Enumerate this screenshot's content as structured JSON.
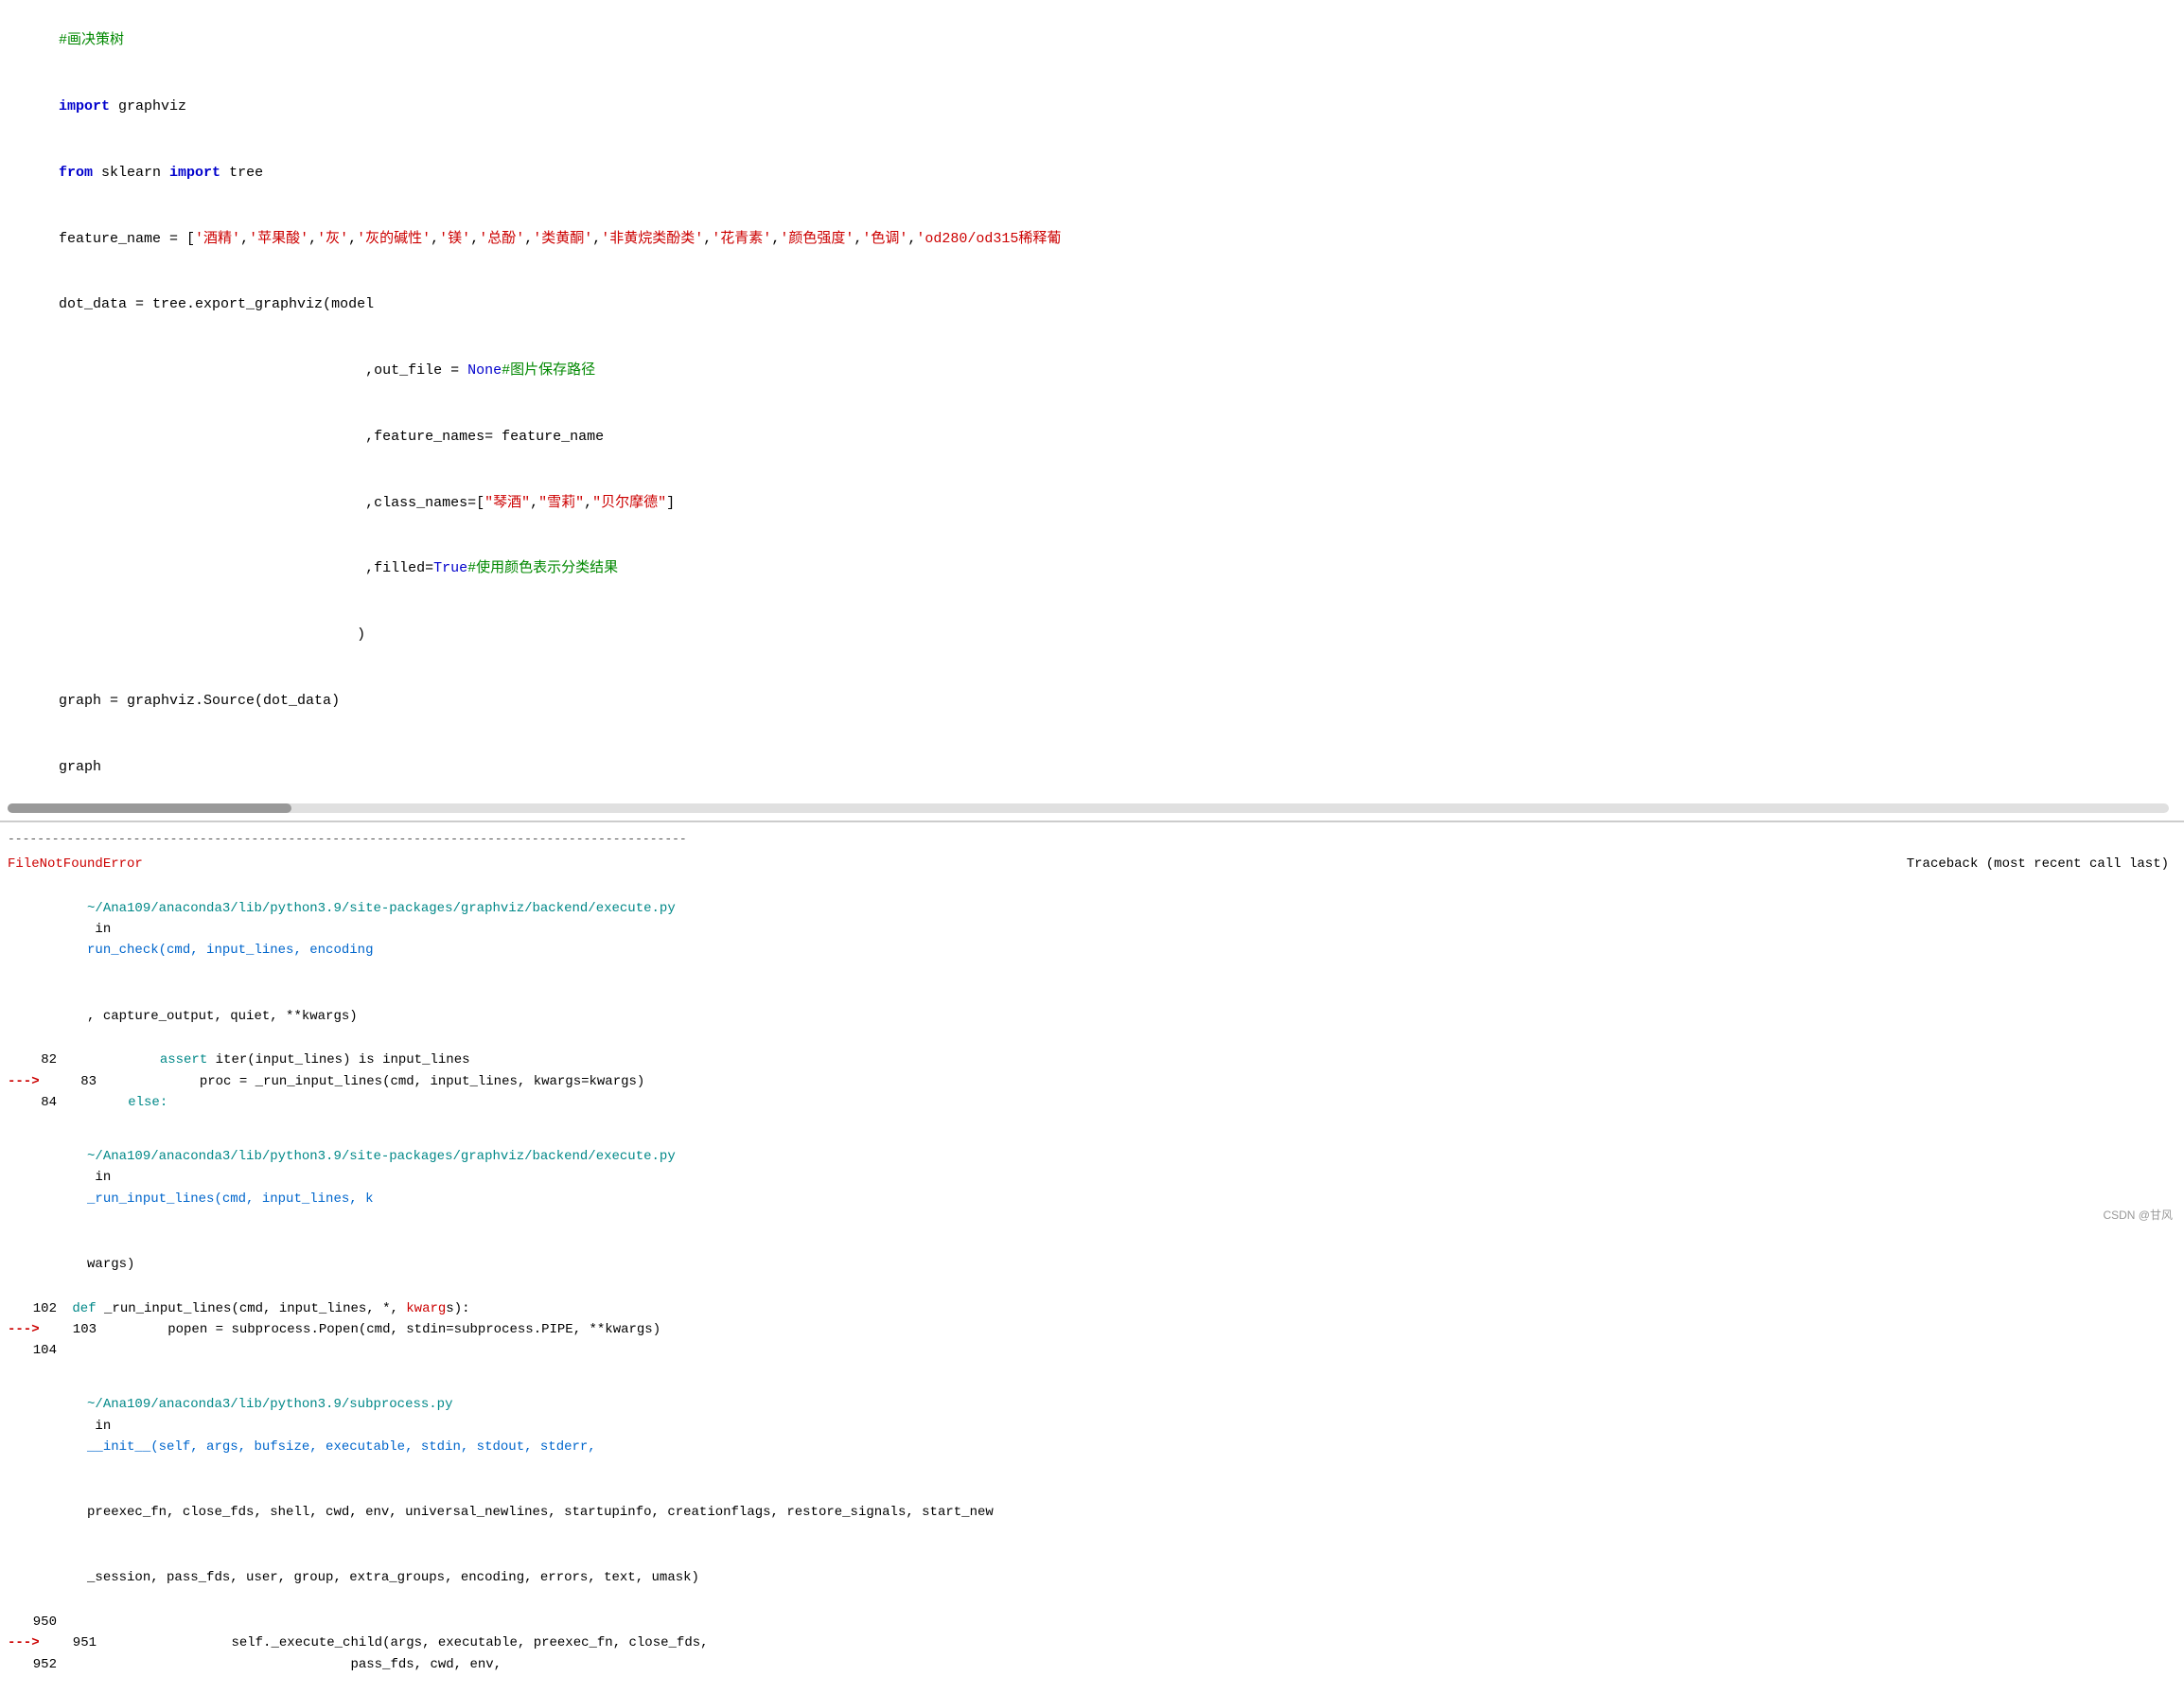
{
  "top_section": {
    "lines": [
      {
        "id": "line1",
        "parts": [
          {
            "text": "#画决策树",
            "class": "comment-title"
          }
        ]
      },
      {
        "id": "line2",
        "parts": [
          {
            "text": "import",
            "class": "kw-import"
          },
          {
            "text": " graphviz",
            "class": "var-name"
          }
        ]
      },
      {
        "id": "line3",
        "parts": [
          {
            "text": "from",
            "class": "kw-from"
          },
          {
            "text": " sklearn ",
            "class": "var-name"
          },
          {
            "text": "import",
            "class": "kw-import"
          },
          {
            "text": " tree",
            "class": "var-name"
          }
        ]
      },
      {
        "id": "line4",
        "parts": [
          {
            "text": "feature_name = [",
            "class": "code-text"
          },
          {
            "text": "'酒精'",
            "class": "string"
          },
          {
            "text": ",",
            "class": "code-text"
          },
          {
            "text": "'苹果酸'",
            "class": "string"
          },
          {
            "text": ",",
            "class": "code-text"
          },
          {
            "text": "'灰'",
            "class": "string"
          },
          {
            "text": ",",
            "class": "code-text"
          },
          {
            "text": "'灰的碱性'",
            "class": "string"
          },
          {
            "text": ",",
            "class": "code-text"
          },
          {
            "text": "'镁'",
            "class": "string"
          },
          {
            "text": ",",
            "class": "code-text"
          },
          {
            "text": "'总酚'",
            "class": "string"
          },
          {
            "text": ",",
            "class": "code-text"
          },
          {
            "text": "'类黄酮'",
            "class": "string"
          },
          {
            "text": ",",
            "class": "code-text"
          },
          {
            "text": "'非黄烷类酚类'",
            "class": "string"
          },
          {
            "text": ",",
            "class": "code-text"
          },
          {
            "text": "'花青素'",
            "class": "string"
          },
          {
            "text": ",",
            "class": "code-text"
          },
          {
            "text": "'颜色强度'",
            "class": "string"
          },
          {
            "text": ",",
            "class": "code-text"
          },
          {
            "text": "'色调'",
            "class": "string"
          },
          {
            "text": ",",
            "class": "code-text"
          },
          {
            "text": "'od280/od315稀释葡",
            "class": "string"
          }
        ]
      },
      {
        "id": "line5",
        "parts": [
          {
            "text": "dot_data = tree.export_graphviz(model",
            "class": "code-text"
          }
        ]
      },
      {
        "id": "line6",
        "parts": [
          {
            "text": "                                    ,out_file = ",
            "class": "code-text"
          },
          {
            "text": "None",
            "class": "kw-none"
          },
          {
            "text": "#图片保存路径",
            "class": "comment-green"
          }
        ]
      },
      {
        "id": "line7",
        "parts": [
          {
            "text": "                                    ,feature_names= feature_name",
            "class": "code-text"
          }
        ]
      },
      {
        "id": "line8",
        "parts": [
          {
            "text": "                                    ,class_names=[",
            "class": "code-text"
          },
          {
            "text": "\"琴酒\"",
            "class": "string"
          },
          {
            "text": ",",
            "class": "code-text"
          },
          {
            "text": "\"雪莉\"",
            "class": "string"
          },
          {
            "text": ",",
            "class": "code-text"
          },
          {
            "text": "\"贝尔摩德\"",
            "class": "string"
          },
          {
            "text": "]",
            "class": "code-text"
          }
        ]
      },
      {
        "id": "line9",
        "parts": [
          {
            "text": "                                    ,filled=",
            "class": "code-text"
          },
          {
            "text": "True",
            "class": "kw-true"
          },
          {
            "text": "#使用颜色表示分类结果",
            "class": "comment-green"
          }
        ]
      },
      {
        "id": "line10",
        "parts": [
          {
            "text": "                                   )",
            "class": "code-text"
          }
        ]
      },
      {
        "id": "line11",
        "parts": [
          {
            "text": "graph = graphviz.Source(dot_data)",
            "class": "code-text"
          }
        ]
      },
      {
        "id": "line12",
        "parts": [
          {
            "text": "graph",
            "class": "code-text"
          }
        ]
      }
    ]
  },
  "error_section": {
    "divider": "--------------------------------------------------------------------------------------------",
    "error_name": "FileNotFoundError",
    "traceback_label": "Traceback (most recent call last)",
    "blocks": [
      {
        "id": "block1",
        "path": "~/Ana109/anaconda3/lib/python3.9/site-packages/graphviz/backend/execute.py",
        "in_text": "in",
        "func_name": "run_check(cmd, input_lines, encoding",
        "extra": ", capture_output, quiet, **kwargs)",
        "lines": [
          {
            "num": "82",
            "arrow": false,
            "code": "            assert iter(input_lines) is input_lines",
            "assert_kw": true
          },
          {
            "num": "83",
            "arrow": true,
            "code": "            proc = _run_input_lines(cmd, input_lines, kwargs=kwargs)"
          },
          {
            "num": "84",
            "arrow": false,
            "code": "        else:"
          }
        ]
      },
      {
        "id": "block2",
        "path": "~/Ana109/anaconda3/lib/python3.9/site-packages/graphviz/backend/execute.py",
        "in_text": "in",
        "func_name": "_run_input_lines(cmd, input_lines, k",
        "extra": "wargs)",
        "lines": [
          {
            "num": "102",
            "arrow": false,
            "code": "    def _run_input_lines(cmd, input_lines, *, kwarg",
            "def_kw": true
          },
          {
            "num": "103",
            "arrow": true,
            "code": "        popen = subprocess.Popen(cmd, stdin=subprocess.PIPE, **kwargs)"
          },
          {
            "num": "104",
            "arrow": false,
            "code": ""
          }
        ]
      },
      {
        "id": "block3",
        "path": "~/Ana109/anaconda3/lib/python3.9/subprocess.py",
        "in_text": "in",
        "func_name": "__init__(self, args, bufsize, executable, stdin, stdout, stderr,",
        "extra": "preexec_fn, close_fds, shell, cwd, env, universal_newlines, startupinfo, creationflags, restore_signals, start_new_session, pass_fds, user, group, extra_groups, encoding, errors, text, umask)",
        "lines": [
          {
            "num": "950",
            "arrow": false,
            "code": ""
          },
          {
            "num": "951",
            "arrow": true,
            "code": "                self._execute_child(args, executable, preexec_fn, close_fds,"
          },
          {
            "num": "952",
            "arrow": false,
            "code": "                                    pass_fds, cwd, env,"
          }
        ]
      }
    ]
  },
  "watermark": "CSDN @甘风"
}
